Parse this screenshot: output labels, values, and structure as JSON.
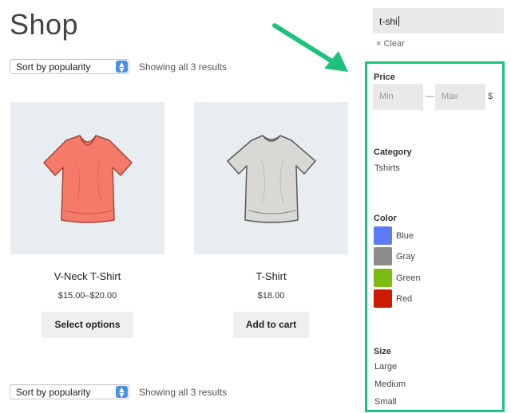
{
  "page": {
    "title": "Shop"
  },
  "sorting": {
    "top": {
      "selected": "Sort by popularity",
      "results": "Showing all 3 results"
    },
    "bottom": {
      "selected": "Sort by popularity",
      "results": "Showing all 3 results"
    }
  },
  "products": [
    {
      "name": "V-Neck T-Shirt",
      "price": "$15.00–$20.00",
      "button": "Select options",
      "image_icon": "vneck-tshirt-icon",
      "color": "#f47a6a"
    },
    {
      "name": "T-Shirt",
      "price": "$18.00",
      "button": "Add to cart",
      "image_icon": "tshirt-icon",
      "color": "#d8d8d4"
    }
  ],
  "search": {
    "value": "t-shi"
  },
  "clear": {
    "label": "× Clear"
  },
  "filters": {
    "price": {
      "heading": "Price",
      "min_placeholder": "Min",
      "max_placeholder": "Max",
      "separator": "—",
      "currency": "$"
    },
    "category": {
      "heading": "Category",
      "items": [
        "Tshirts"
      ]
    },
    "color": {
      "heading": "Color",
      "items": [
        {
          "label": "Blue",
          "swatch": "#5b7cf5"
        },
        {
          "label": "Gray",
          "swatch": "#8c8c8c"
        },
        {
          "label": "Green",
          "swatch": "#7cbb12"
        },
        {
          "label": "Red",
          "swatch": "#cc1c00"
        }
      ]
    },
    "size": {
      "heading": "Size",
      "items": [
        "Large",
        "Medium",
        "Small"
      ]
    }
  },
  "annotation": {
    "color": "#1ec27e"
  }
}
